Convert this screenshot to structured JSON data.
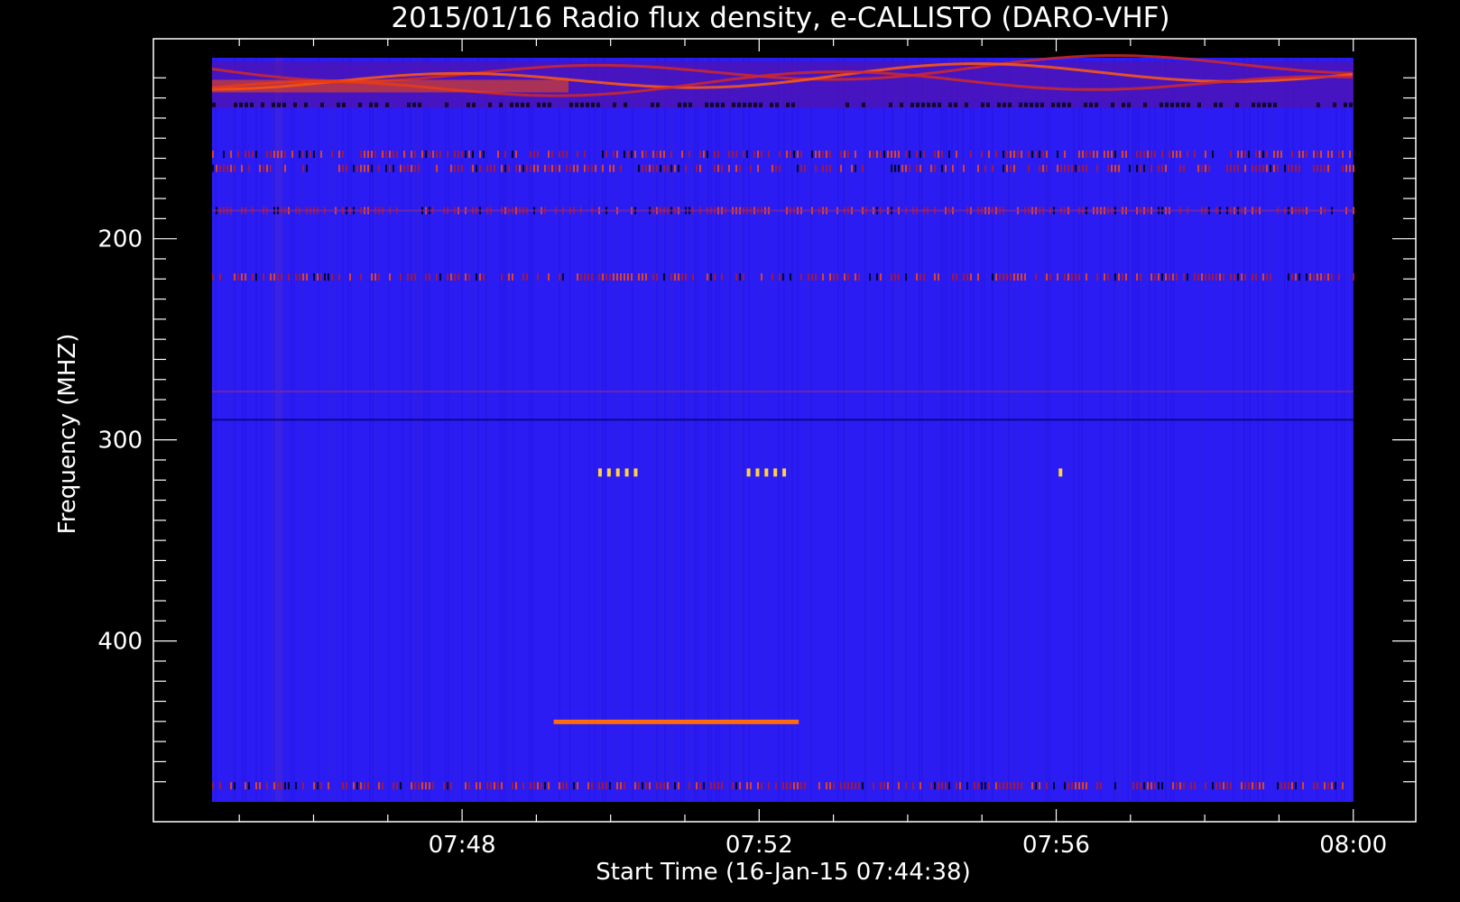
{
  "chart_data": {
    "type": "heatmap",
    "title": "2015/01/16  Radio flux density, e-CALLISTO (DARO-VHF)",
    "xlabel": "Start Time (16-Jan-15 07:44:38)",
    "ylabel": "Frequency (MHZ)",
    "x_tick_labels": [
      "07:48",
      "07:52",
      "07:56",
      "08:00"
    ],
    "y_tick_labels": [
      "200",
      "300",
      "400"
    ],
    "x_range_minutes": [
      0,
      15.37
    ],
    "y_range_mhz": [
      110,
      480
    ],
    "y_axis_inverted": true,
    "colormap": [
      "#000000",
      "#1a00ff",
      "#ff2a00",
      "#ffffff"
    ],
    "background_color": "#2a1cf2",
    "features": [
      {
        "kind": "strong emission band",
        "freq_mhz": [
          112,
          135
        ],
        "time_min": [
          0,
          15.37
        ]
      },
      {
        "kind": "interference row",
        "freq_mhz": 158,
        "time_min": [
          0,
          15.37
        ]
      },
      {
        "kind": "interference row",
        "freq_mhz": 165,
        "time_min": [
          0,
          15.37
        ]
      },
      {
        "kind": "interference row",
        "freq_mhz": 186,
        "time_min": [
          0,
          15.37
        ]
      },
      {
        "kind": "interference row",
        "freq_mhz": 219,
        "time_min": [
          0,
          15.37
        ]
      },
      {
        "kind": "narrowband line",
        "freq_mhz": 440,
        "time_min": [
          4.6,
          7.9
        ]
      },
      {
        "kind": "spots",
        "freq_mhz": 316,
        "time_min": [
          5.2,
          5.7
        ]
      },
      {
        "kind": "spots",
        "freq_mhz": 316,
        "time_min": [
          7.2,
          7.7
        ]
      },
      {
        "kind": "spots",
        "freq_mhz": 316,
        "time_min": [
          11.4,
          11.5
        ]
      },
      {
        "kind": "interference row",
        "freq_mhz": 472,
        "time_min": [
          0,
          15.37
        ]
      }
    ]
  }
}
